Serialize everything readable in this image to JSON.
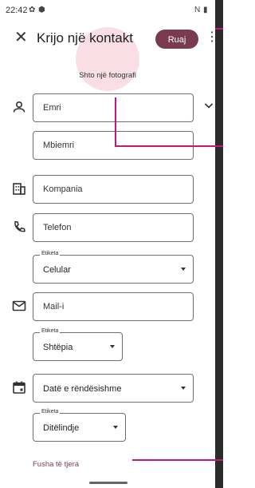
{
  "status_bar": {
    "time": "22:42",
    "left_icons": [
      "settings-icon",
      "shield-icon"
    ],
    "right_icons": [
      "nfc-icon",
      "battery-icon"
    ]
  },
  "appbar": {
    "title": "Krijo një kontakt",
    "save_label": "Ruaj"
  },
  "photo": {
    "label": "Shto një fotografi"
  },
  "fields": {
    "first_name": "Emri",
    "last_name": "Mbiemri",
    "company": "Kompania",
    "phone": "Telefon",
    "phone_label": {
      "label": "Etiketa",
      "value": "Celular"
    },
    "email": "Mail-i",
    "email_label": {
      "label": "Etiketa",
      "value": "Shtëpia"
    },
    "date": "Datë e rëndësishme",
    "date_label": {
      "label": "Etiketa",
      "value": "Ditëlindje"
    }
  },
  "more_fields": "Fusha të tjera",
  "colors": {
    "accent": "#7a3b52",
    "annotation": "#c2187a",
    "photo_bg": "#f9dfe5"
  }
}
